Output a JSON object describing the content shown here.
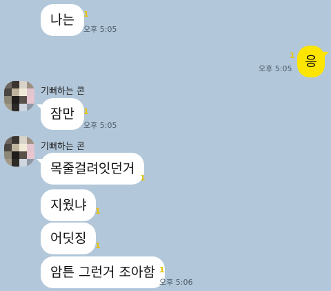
{
  "colors": {
    "background": "#b2c7d9",
    "bubble_other": "#ffffff",
    "bubble_mine": "#fee500",
    "unread": "#e6c200"
  },
  "messages": [
    {
      "text": "나는",
      "unread": "1",
      "time": "오후 5:05"
    },
    {
      "text": "응",
      "unread": "1",
      "time": "오후 5:05"
    },
    {
      "sender": "기뻐하는 콘",
      "text": "잠만",
      "unread": "1",
      "time": "오후 5:05"
    },
    {
      "sender": "기뻐하는 콘",
      "text": "목줄걸려잇던거",
      "unread": "1"
    },
    {
      "text": "지웠냐",
      "unread": "1"
    },
    {
      "text": "어딧징",
      "unread": "1"
    },
    {
      "text": "암튼 그런거 조아함",
      "unread": "1",
      "time": "오후 5:06"
    }
  ]
}
